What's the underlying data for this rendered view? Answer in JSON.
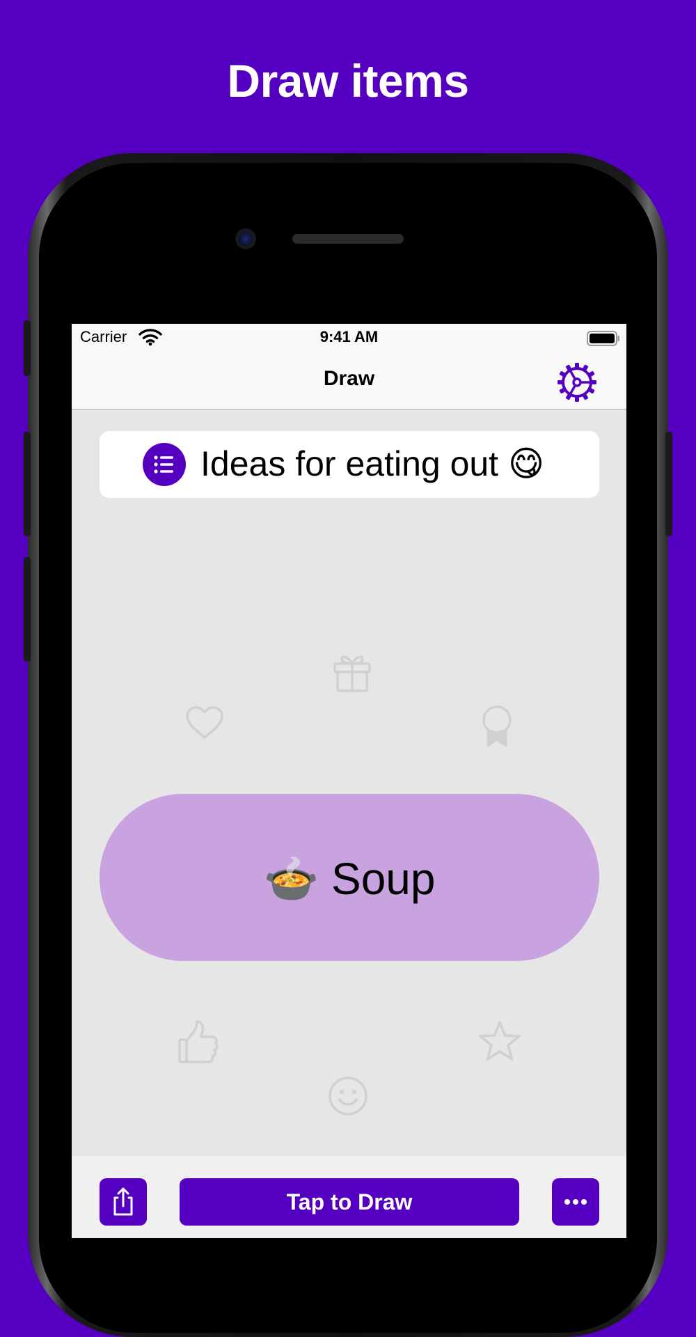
{
  "headline": "Draw items",
  "status_bar": {
    "carrier": "Carrier",
    "time": "9:41 AM"
  },
  "nav": {
    "title": "Draw"
  },
  "list": {
    "title": "Ideas for eating out 😋"
  },
  "result": {
    "text": "🍲 Soup"
  },
  "bottom_bar": {
    "draw_label": "Tap to Draw"
  },
  "colors": {
    "accent": "#5500c0",
    "result_fill": "#c9a3e0",
    "background": "#e6e6e6"
  },
  "icons": [
    "wifi-icon",
    "battery-icon",
    "gear-icon",
    "list-icon",
    "gift-icon",
    "heart-icon",
    "award-icon",
    "thumbs-up-icon",
    "star-icon",
    "smiley-icon",
    "share-icon",
    "ellipsis-icon"
  ]
}
